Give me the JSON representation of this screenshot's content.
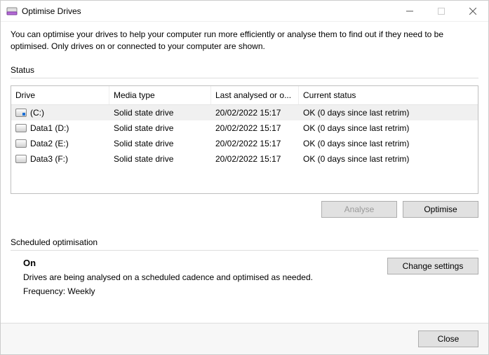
{
  "window": {
    "title": "Optimise Drives"
  },
  "intro": "You can optimise your drives to help your computer run more efficiently or analyse them to find out if they need to be optimised. Only drives on or connected to your computer are shown.",
  "status_label": "Status",
  "columns": {
    "drive": "Drive",
    "media": "Media type",
    "last": "Last analysed or o...",
    "status": "Current status"
  },
  "drives": [
    {
      "name": "(C:)",
      "media": "Solid state drive",
      "last": "20/02/2022 15:17",
      "status": "OK (0 days since last retrim)",
      "icon": "c",
      "selected": true
    },
    {
      "name": "Data1 (D:)",
      "media": "Solid state drive",
      "last": "20/02/2022 15:17",
      "status": "OK (0 days since last retrim)",
      "icon": "",
      "selected": false
    },
    {
      "name": "Data2 (E:)",
      "media": "Solid state drive",
      "last": "20/02/2022 15:17",
      "status": "OK (0 days since last retrim)",
      "icon": "",
      "selected": false
    },
    {
      "name": "Data3 (F:)",
      "media": "Solid state drive",
      "last": "20/02/2022 15:17",
      "status": "OK (0 days since last retrim)",
      "icon": "",
      "selected": false
    }
  ],
  "buttons": {
    "analyse": "Analyse",
    "optimise": "Optimise",
    "change_settings": "Change settings",
    "close": "Close"
  },
  "schedule": {
    "label": "Scheduled optimisation",
    "on": "On",
    "desc": "Drives are being analysed on a scheduled cadence and optimised as needed.",
    "freq": "Frequency: Weekly"
  }
}
